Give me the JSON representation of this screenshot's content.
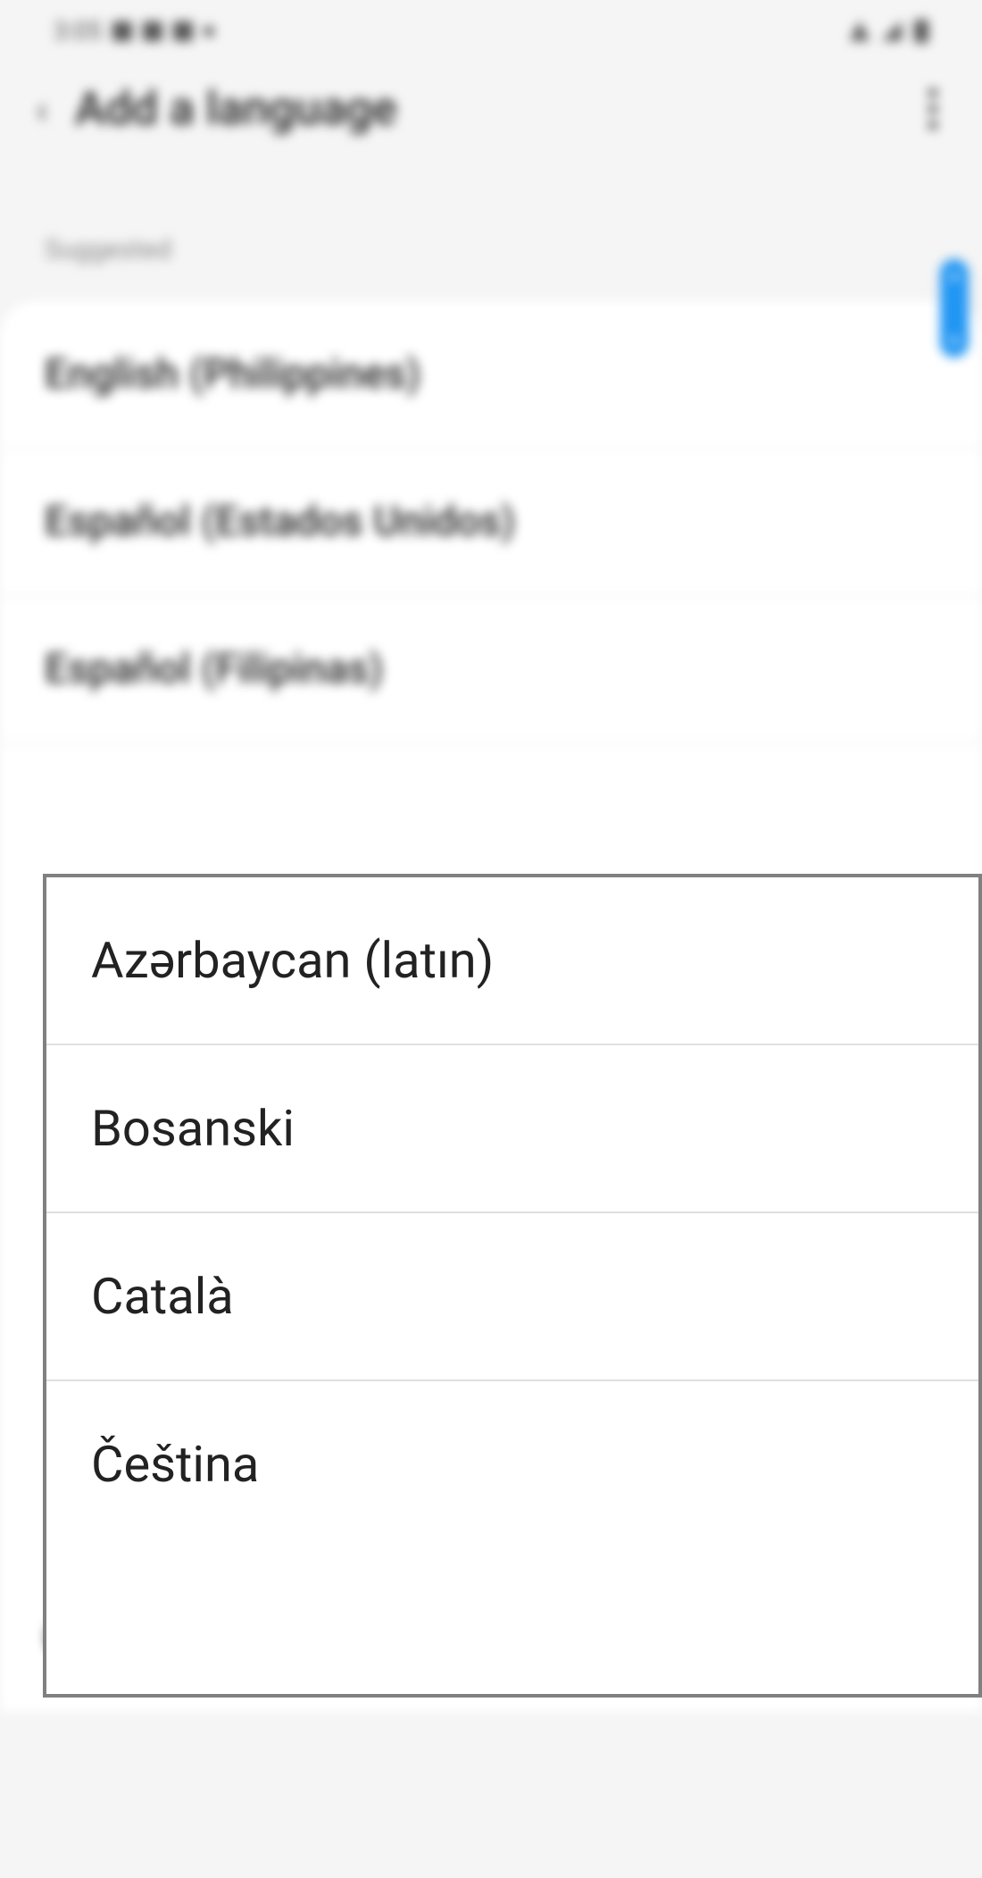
{
  "status": {
    "time": "3:05"
  },
  "header": {
    "title": "Add a language"
  },
  "section": {
    "suggested_label": "Suggested"
  },
  "suggested_items": [
    "English (Philippines)",
    "Español (Estados Unidos)",
    "Español (Filipinas)"
  ],
  "continuation_item": "Čeština",
  "popup_items": [
    "Azərbaycan (latın)",
    "Bosanski",
    "Català",
    "Čeština"
  ]
}
